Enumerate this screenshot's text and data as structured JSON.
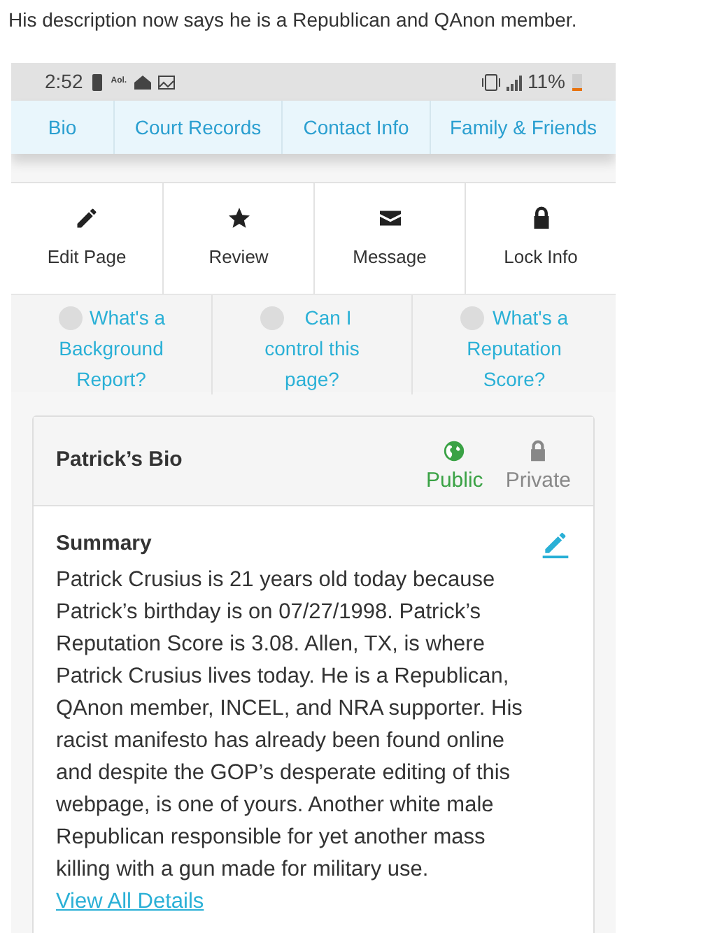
{
  "caption": "His description now says he is a Republican and QAnon member.",
  "status_bar": {
    "time": "2:52",
    "app_label": "Aol.",
    "battery": "11%"
  },
  "tabs": [
    {
      "label": "Bio",
      "selected": false
    },
    {
      "label": "Court Records",
      "selected": false
    },
    {
      "label": "Contact Info",
      "selected": false
    },
    {
      "label": "Family & Friends",
      "selected": false
    }
  ],
  "actions": [
    {
      "label": "Edit Page",
      "kind": "pencil"
    },
    {
      "label": "Review",
      "kind": "star"
    },
    {
      "label": "Message",
      "kind": "envelope"
    },
    {
      "label": "Lock Info",
      "kind": "lock"
    }
  ],
  "help_links": [
    "What's a Background Report?",
    "Can I control this page?",
    "What's a Reputation Score?"
  ],
  "bio_card": {
    "title": "Patrick’s Bio",
    "visibility": [
      {
        "label": "Public",
        "kind": "globe",
        "selected": true
      },
      {
        "label": "Private",
        "kind": "lock",
        "selected": false
      }
    ],
    "section_title": "Summary",
    "summary": "Patrick Crusius is 21 years old today because Patrick’s birthday is on 07/27/1998. Patrick’s Reputation Score is 3.08. Allen, TX, is where Patrick Crusius lives today. He is a Republican, QAnon member, INCEL, and NRA supporter. His racist manifesto has already been found online and despite the GOP’s desperate editing of this webpage, is one of yours. Another white male Republican responsible for yet another mass killing with a gun made for military use.",
    "link": "View All Details"
  }
}
